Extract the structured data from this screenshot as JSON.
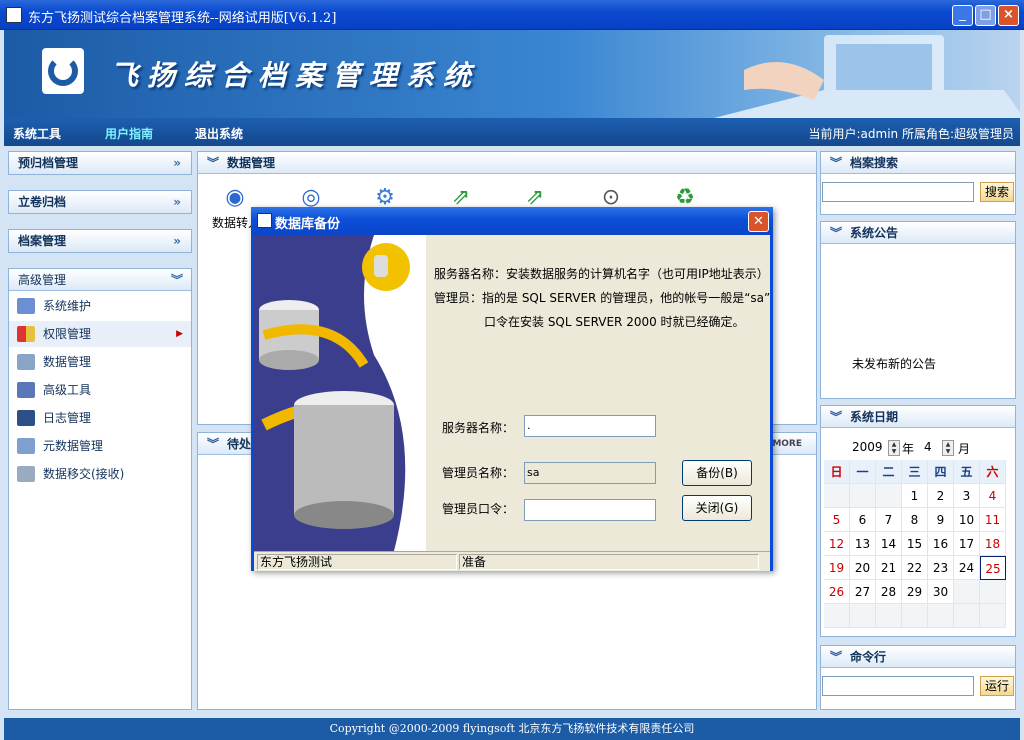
{
  "window": {
    "title": "东方飞扬测试综合档案管理系统--网络试用版[V6.1.2]"
  },
  "banner": {
    "title": "飞扬综合档案管理系统"
  },
  "nav": {
    "items": [
      "系统工具",
      "用户指南",
      "退出系统"
    ],
    "user": "当前用户:admin  所属角色:超级管理员"
  },
  "left": {
    "sections": [
      "预归档管理",
      "立卷归档",
      "档案管理",
      "高级管理"
    ],
    "menu": [
      "系统维护",
      "权限管理",
      "数据管理",
      "高级工具",
      "日志管理",
      "元数据管理",
      "数据移交(接收)"
    ],
    "selected": "权限管理"
  },
  "main": {
    "title": "数据管理",
    "tool_label": "数据转入",
    "pending_title": "待处理",
    "more": "MORE"
  },
  "right": {
    "search_title": "档案搜索",
    "search_button": "搜索",
    "notice_title": "系统公告",
    "notice_text": "未发布新的公告",
    "date_title": "系统日期",
    "year": "2009",
    "year_label": "年",
    "month": "4",
    "month_label": "月",
    "weekdays": [
      "日",
      "一",
      "二",
      "三",
      "四",
      "五",
      "六"
    ],
    "weeks": [
      [
        "",
        "",
        "",
        "1",
        "2",
        "3",
        "4"
      ],
      [
        "5",
        "6",
        "7",
        "8",
        "9",
        "10",
        "11"
      ],
      [
        "12",
        "13",
        "14",
        "15",
        "16",
        "17",
        "18"
      ],
      [
        "19",
        "20",
        "21",
        "22",
        "23",
        "24",
        "25"
      ],
      [
        "26",
        "27",
        "28",
        "29",
        "30",
        "",
        ""
      ],
      [
        "",
        "",
        "",
        "",
        "",
        "",
        ""
      ]
    ],
    "today": "25",
    "cmd_title": "命令行",
    "run_button": "运行"
  },
  "dialog": {
    "title": "数据库备份",
    "line1": "服务器名称：安装数据服务的计算机名字（也可用IP地址表示）",
    "line2": "管理员：指的是 SQL SERVER  的管理员，他的帐号一般是“sa”",
    "line3": "口令在安装 SQL SERVER 2000  时就已经确定。",
    "server_label": "服务器名称：",
    "server_value": ".",
    "admin_label": "管理员名称：",
    "admin_value": "sa",
    "pwd_label": "管理员口令：",
    "pwd_value": "",
    "backup_button": "备份(B)",
    "close_button": "关闭(G)",
    "status_left": "东方飞扬测试",
    "status_right": "准备"
  },
  "footer": {
    "text": "Copyright @2000-2009 flyingsoft 北京东方飞扬软件技术有限责任公司"
  }
}
